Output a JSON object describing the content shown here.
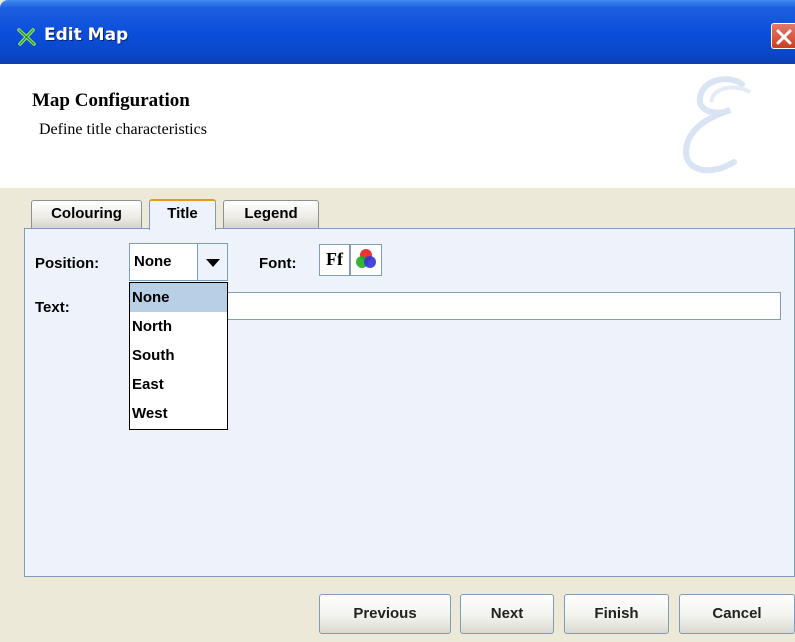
{
  "window": {
    "title": "Edit Map"
  },
  "header": {
    "title": "Map Configuration",
    "subtitle": "Define title characteristics"
  },
  "tabs": [
    {
      "label": "Colouring",
      "active": false
    },
    {
      "label": "Title",
      "active": true
    },
    {
      "label": "Legend",
      "active": false
    }
  ],
  "form": {
    "position_label": "Position:",
    "position_value": "None",
    "font_label": "Font:",
    "font_button": "Ff",
    "text_label": "Text:",
    "text_value": ""
  },
  "dropdown": {
    "options": [
      "None",
      "North",
      "South",
      "East",
      "West"
    ],
    "selected": "None"
  },
  "buttons": {
    "previous": "Previous",
    "next": "Next",
    "finish": "Finish",
    "cancel": "Cancel"
  },
  "icons": {
    "app": "map-icon",
    "close": "close-icon",
    "watermark": "watermark-e-icon",
    "dropdown": "chevron-down-icon",
    "color": "color-palette-icon"
  },
  "colors": {
    "titlebar": "#0a4fdc",
    "close": "#d5512f",
    "panel": "#eef3fb",
    "selection": "#b8cfe5",
    "tab_highlight": "#e69a18"
  }
}
